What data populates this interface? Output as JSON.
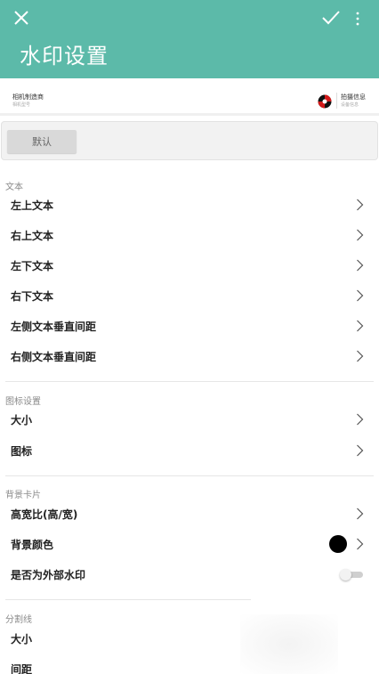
{
  "appbar": {
    "title": "水印设置",
    "color": "#5cbaa9",
    "close_icon": "close-icon",
    "confirm_icon": "check-icon",
    "more_icon": "more-vert-icon"
  },
  "preview": {
    "left_line1": "相机制造商",
    "left_line2": "相机型号",
    "right_line1": "拍摄信息",
    "right_line2": "设备信息",
    "logo_icon": "brand-logo-icon"
  },
  "default_button": "默认",
  "sections": {
    "text": {
      "label": "文本",
      "items": [
        "左上文本",
        "右上文本",
        "左下文本",
        "右下文本",
        "左侧文本垂直间距",
        "右侧文本垂直间距"
      ]
    },
    "icon": {
      "label": "图标设置",
      "items": [
        "大小",
        "图标"
      ]
    },
    "background": {
      "label": "背景卡片",
      "items": [
        "高宽比(高/宽)",
        "背景颜色",
        "是否为外部水印"
      ],
      "color_value": "#000000",
      "external_watermark": false
    },
    "divider": {
      "label": "分割线",
      "items": [
        "大小",
        "间距"
      ]
    }
  }
}
